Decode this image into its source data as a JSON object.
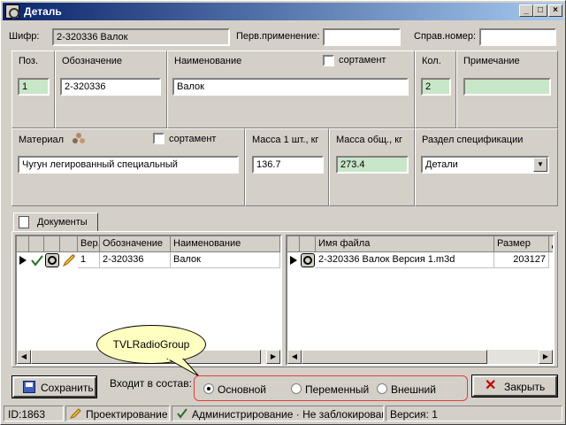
{
  "window": {
    "title": "Деталь",
    "controls": [
      "_",
      "□",
      "×"
    ]
  },
  "top": {
    "cipher_label": "Шифр:",
    "cipher_value": "2-320336 Валок",
    "first_use_label": "Перв.применение:",
    "first_use_value": "",
    "ref_number_label": "Справ.номер:",
    "ref_number_value": ""
  },
  "row1": {
    "pos_label": "Поз.",
    "pos_value": "1",
    "designation_label": "Обозначение",
    "designation_value": "2-320336",
    "name_label": "Наименование",
    "name_value": "Валок",
    "assortment_label": "сортамент",
    "qty_label": "Кол.",
    "qty_value": "2",
    "note_label": "Примечание",
    "note_value": ""
  },
  "row2": {
    "material_label": "Материал",
    "material_value": "Чугун легированный специальный",
    "assortment_label": "сортамент",
    "mass_unit_label": "Масса 1 шт., кг",
    "mass_unit_value": "136.7",
    "mass_total_label": "Масса общ., кг",
    "mass_total_value": "273.4",
    "spec_section_label": "Раздел спецификации",
    "spec_section_value": "Детали"
  },
  "tabs": {
    "documents": "Документы"
  },
  "left_grid": {
    "headers": [
      "",
      "",
      "",
      "",
      "Вер.",
      "Обозначение",
      "Наименование"
    ],
    "rows": [
      {
        "ver": "1",
        "designation": "2-320336",
        "name": "Валок"
      }
    ]
  },
  "right_grid": {
    "headers": [
      "",
      "",
      "Имя файла",
      "Размер",
      "Д"
    ],
    "rows": [
      {
        "filename": "2-320336 Валок Версия 1.m3d",
        "size": "203127"
      }
    ]
  },
  "callout": "TVLRadioGroup",
  "bottom": {
    "save_label": "Сохранить",
    "included_label": "Входит в состав:",
    "radio_options": [
      "Основной",
      "Переменный",
      "Внешний"
    ],
    "radio_selected": "Основной",
    "close_label": "Закрыть"
  },
  "status": {
    "id": "ID:1863",
    "stage": "Проектирование",
    "admin": "Администрирование · Не заблокирован",
    "version": "Версия: 1"
  },
  "colors": {
    "title_start": "#0a246a",
    "title_end": "#a6caf0",
    "green_field": "#c8e6c8",
    "red_outline": "#e04040",
    "callout_bg": "#ffffc0"
  }
}
